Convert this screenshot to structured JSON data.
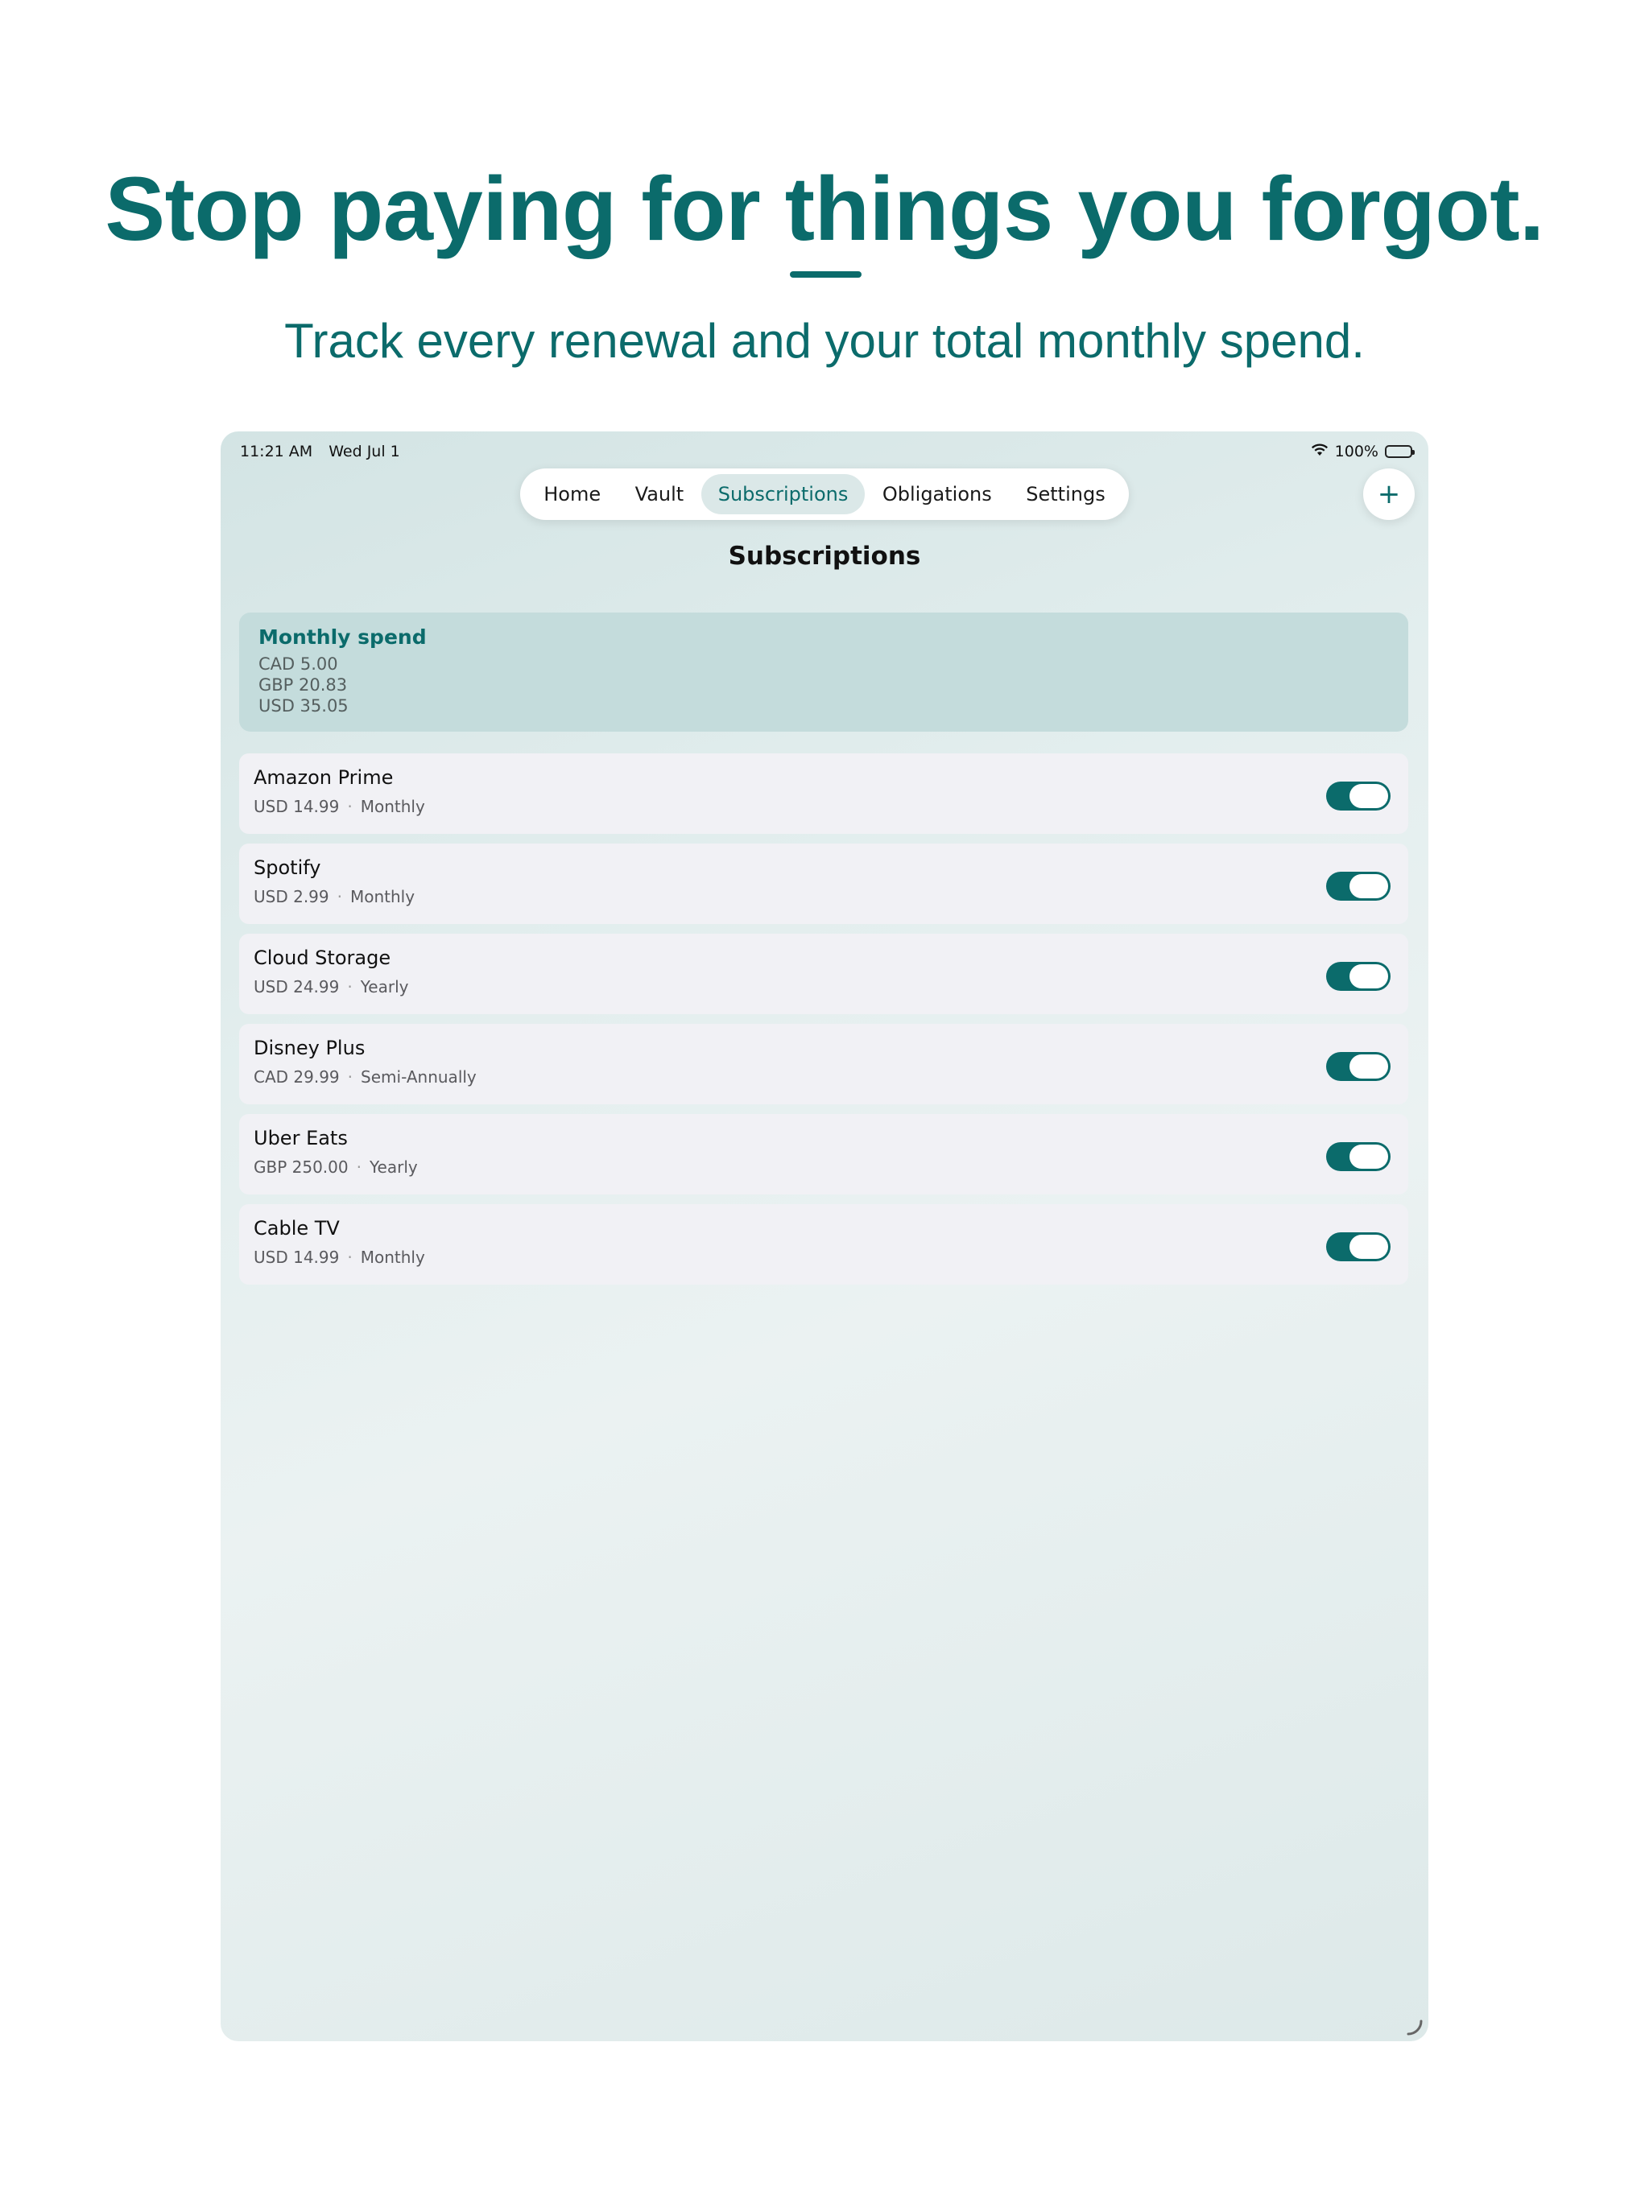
{
  "marketing": {
    "headline": "Stop paying for things you forgot.",
    "subheadline": "Track every renewal and your total monthly spend."
  },
  "status_bar": {
    "time": "11:21 AM",
    "date": "Wed Jul 1",
    "battery": "100%"
  },
  "tabs": [
    {
      "label": "Home",
      "active": false
    },
    {
      "label": "Vault",
      "active": false
    },
    {
      "label": "Subscriptions",
      "active": true
    },
    {
      "label": "Obligations",
      "active": false
    },
    {
      "label": "Settings",
      "active": false
    }
  ],
  "add_button": {
    "icon": "plus-icon",
    "glyph": "+"
  },
  "page": {
    "title": "Subscriptions"
  },
  "summary": {
    "title": "Monthly spend",
    "lines": [
      "CAD 5.00",
      "GBP 20.83",
      "USD 35.05"
    ]
  },
  "subscriptions": [
    {
      "name": "Amazon Prime",
      "amount": "USD 14.99",
      "separator": "·",
      "frequency": "Monthly",
      "enabled": true
    },
    {
      "name": "Spotify",
      "amount": "USD 2.99",
      "separator": "·",
      "frequency": "Monthly",
      "enabled": true
    },
    {
      "name": "Cloud Storage",
      "amount": "USD 24.99",
      "separator": "·",
      "frequency": "Yearly",
      "enabled": true
    },
    {
      "name": "Disney Plus",
      "amount": "CAD 29.99",
      "separator": "·",
      "frequency": "Semi-Annually",
      "enabled": true
    },
    {
      "name": "Uber Eats",
      "amount": "GBP 250.00",
      "separator": "·",
      "frequency": "Yearly",
      "enabled": true
    },
    {
      "name": "Cable TV",
      "amount": "USD 14.99",
      "separator": "·",
      "frequency": "Monthly",
      "enabled": true
    }
  ],
  "colors": {
    "accent": "#0b6b6b",
    "summary_background": "#c4dcdc",
    "row_background": "#f1f1f5"
  }
}
